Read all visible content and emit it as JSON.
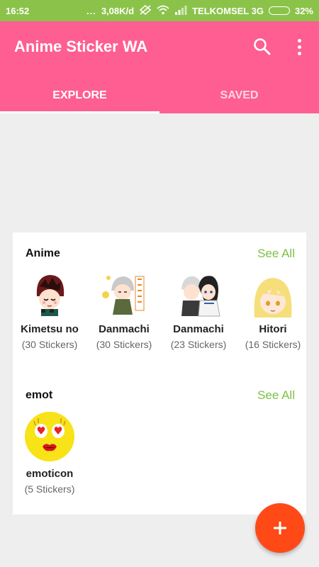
{
  "status_bar": {
    "time": "16:52",
    "dots": "...",
    "speed": "3,08K/d",
    "carrier": "TELKOMSEL 3G",
    "battery": "32%",
    "battery_level": 0.32
  },
  "app": {
    "title": "Anime Sticker WA",
    "search_icon": "search-icon",
    "more_icon": "more-vert-icon",
    "accent_color": "#fe5e91",
    "status_color": "#8bc34a"
  },
  "tabs": [
    {
      "label": "EXPLORE",
      "active": true
    },
    {
      "label": "SAVED",
      "active": false
    }
  ],
  "sections": [
    {
      "title": "Anime",
      "see_all": "See All",
      "packs": [
        {
          "name": "Kimetsu no",
          "count": "(30 Stickers)"
        },
        {
          "name": "Danmachi",
          "count": "(30 Stickers)"
        },
        {
          "name": "Danmachi",
          "count": "(23 Stickers)"
        },
        {
          "name": "Hitori",
          "count": "(16 Stickers)"
        }
      ]
    },
    {
      "title": "emot",
      "see_all": "See All",
      "packs": [
        {
          "name": "emoticon",
          "count": "(5 Stickers)"
        }
      ]
    }
  ],
  "fab": {
    "icon": "plus-icon",
    "color": "#ff4a18"
  }
}
